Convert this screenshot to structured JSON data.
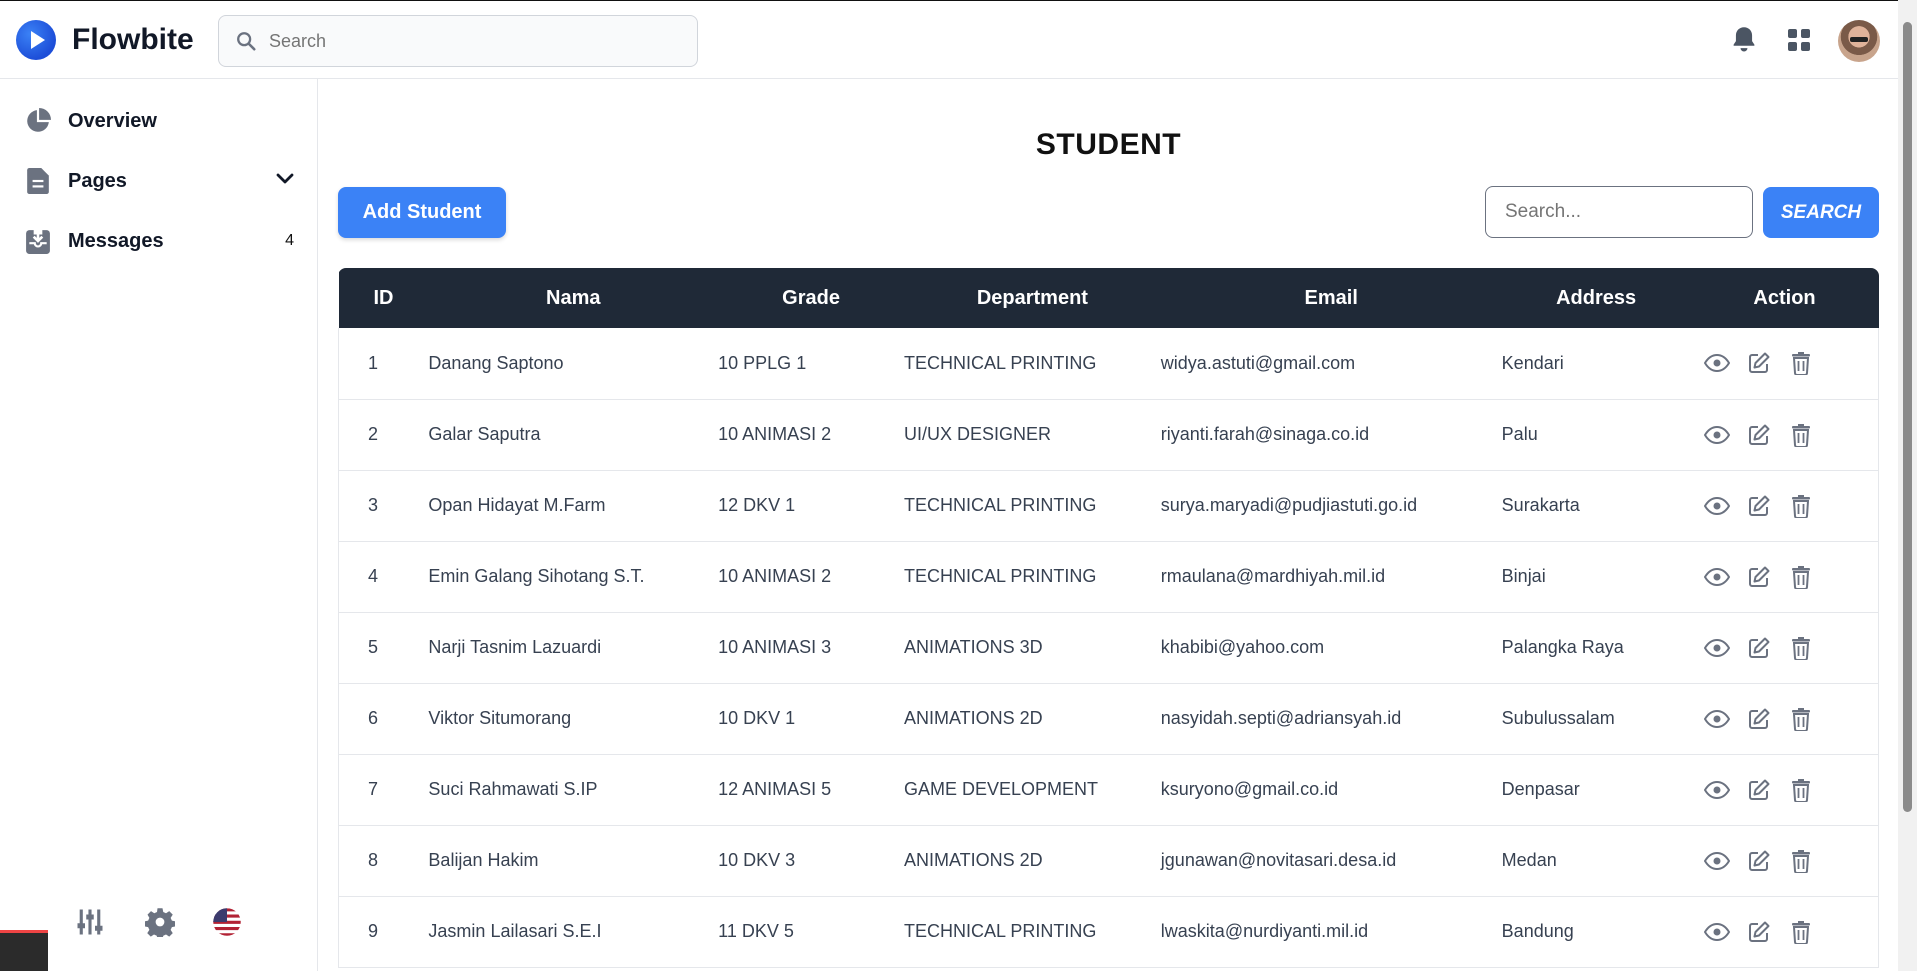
{
  "app": {
    "name": "Flowbite"
  },
  "top_search": {
    "placeholder": "Search"
  },
  "sidebar": {
    "items": [
      {
        "label": "Overview"
      },
      {
        "label": "Pages"
      },
      {
        "label": "Messages",
        "badge": "4"
      }
    ]
  },
  "page": {
    "title": "STUDENT",
    "add_button": "Add Student",
    "search_placeholder": "Search...",
    "search_button": "SEARCH"
  },
  "table": {
    "headers": [
      "ID",
      "Nama",
      "Grade",
      "Department",
      "Email",
      "Address",
      "Action"
    ],
    "rows": [
      {
        "id": "1",
        "nama": "Danang Saptono",
        "grade": "10 PPLG 1",
        "department": "TECHNICAL PRINTING",
        "email": "widya.astuti@gmail.com",
        "address": "Kendari"
      },
      {
        "id": "2",
        "nama": "Galar Saputra",
        "grade": "10 ANIMASI 2",
        "department": "UI/UX DESIGNER",
        "email": "riyanti.farah@sinaga.co.id",
        "address": "Palu"
      },
      {
        "id": "3",
        "nama": "Opan Hidayat M.Farm",
        "grade": "12 DKV 1",
        "department": "TECHNICAL PRINTING",
        "email": "surya.maryadi@pudjiastuti.go.id",
        "address": "Surakarta"
      },
      {
        "id": "4",
        "nama": "Emin Galang Sihotang S.T.",
        "grade": "10 ANIMASI 2",
        "department": "TECHNICAL PRINTING",
        "email": "rmaulana@mardhiyah.mil.id",
        "address": "Binjai"
      },
      {
        "id": "5",
        "nama": "Narji Tasnim Lazuardi",
        "grade": "10 ANIMASI 3",
        "department": "ANIMATIONS 3D",
        "email": "khabibi@yahoo.com",
        "address": "Palangka Raya"
      },
      {
        "id": "6",
        "nama": "Viktor Situmorang",
        "grade": "10 DKV 1",
        "department": "ANIMATIONS 2D",
        "email": "nasyidah.septi@adriansyah.id",
        "address": "Subulussalam"
      },
      {
        "id": "7",
        "nama": "Suci Rahmawati S.IP",
        "grade": "12 ANIMASI 5",
        "department": "GAME DEVELOPMENT",
        "email": "ksuryono@gmail.co.id",
        "address": "Denpasar"
      },
      {
        "id": "8",
        "nama": "Balijan Hakim",
        "grade": "10 DKV 3",
        "department": "ANIMATIONS 2D",
        "email": "jgunawan@novitasari.desa.id",
        "address": "Medan"
      },
      {
        "id": "9",
        "nama": "Jasmin Lailasari S.E.I",
        "grade": "11 DKV 5",
        "department": "TECHNICAL PRINTING",
        "email": "lwaskita@nurdiyanti.mil.id",
        "address": "Bandung"
      }
    ]
  },
  "colors": {
    "primary": "#3b82f6",
    "header_bg": "#1f2937",
    "icon_gray": "#6b7280"
  }
}
